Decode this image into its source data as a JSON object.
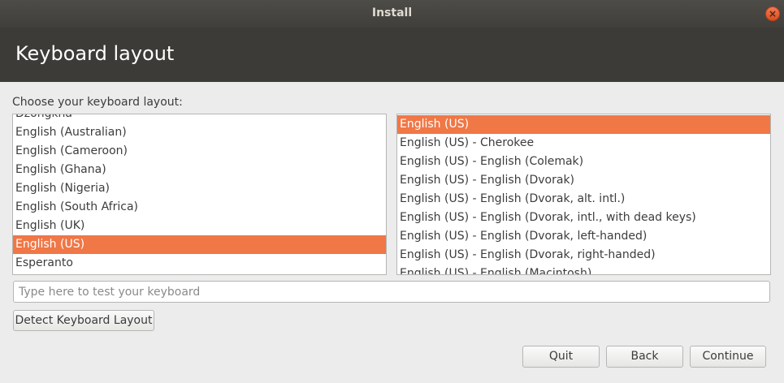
{
  "window": {
    "title": "Install"
  },
  "header": {
    "title": "Keyboard layout"
  },
  "prompt": "Choose your keyboard layout:",
  "layouts": {
    "items": [
      "Dzongkha",
      "English (Australian)",
      "English (Cameroon)",
      "English (Ghana)",
      "English (Nigeria)",
      "English (South Africa)",
      "English (UK)",
      "English (US)",
      "Esperanto"
    ],
    "selected": "English (US)"
  },
  "variants": {
    "items": [
      "English (US)",
      "English (US) - Cherokee",
      "English (US) - English (Colemak)",
      "English (US) - English (Dvorak)",
      "English (US) - English (Dvorak, alt. intl.)",
      "English (US) - English (Dvorak, intl., with dead keys)",
      "English (US) - English (Dvorak, left-handed)",
      "English (US) - English (Dvorak, right-handed)",
      "English (US) - English (Macintosh)"
    ],
    "selected": "English (US)"
  },
  "test_field": {
    "placeholder": "Type here to test your keyboard",
    "value": ""
  },
  "buttons": {
    "detect": "Detect Keyboard Layout",
    "quit": "Quit",
    "back": "Back",
    "continue": "Continue"
  },
  "colors": {
    "selection": "#f07746",
    "header_bg": "#3c3b37",
    "titlebar_bg": "#45443f",
    "close_button": "#e95420"
  },
  "icons": {
    "close": "close-icon"
  }
}
